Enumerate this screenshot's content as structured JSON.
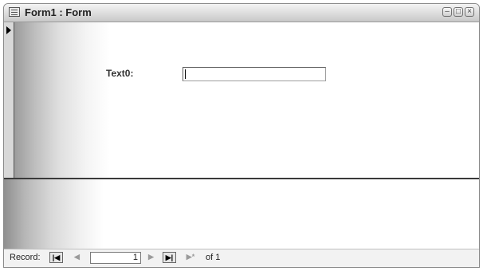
{
  "window": {
    "title": "Form1 : Form"
  },
  "form": {
    "text_label": "Text0:",
    "text_value": ""
  },
  "navigation": {
    "record_label": "Record:",
    "current_record": "1",
    "of_label": "of 1"
  },
  "icons": {
    "first": "first-record-icon",
    "prev": "previous-record-icon",
    "next": "next-record-icon",
    "last": "last-record-icon",
    "new": "new-record-icon",
    "glyphs": {
      "first": "|◀",
      "prev": "◀",
      "next": "▶",
      "last": "▶|",
      "new": "▶*",
      "minimize": "–",
      "restore": "□",
      "close": "×"
    }
  },
  "colors": {
    "divider": "#3a3a3a",
    "selector": "#d8d8d8",
    "titlebar": "#dcdcdc"
  }
}
